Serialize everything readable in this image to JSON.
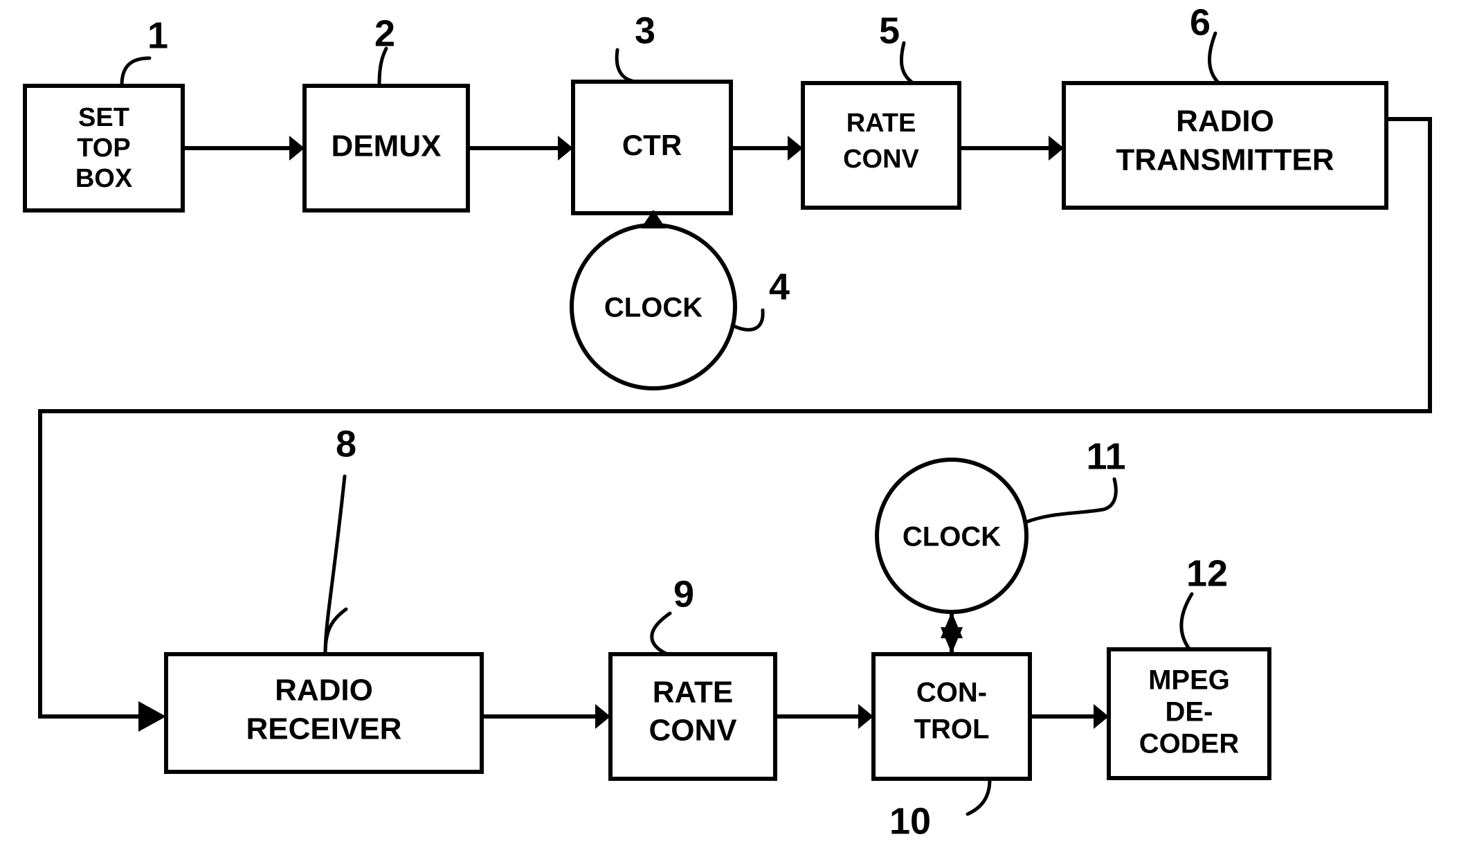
{
  "figure": {
    "type": "patent-block-diagram",
    "background_color": "#ffffff",
    "line_color": "#000000"
  },
  "blocks": {
    "set_top_box": {
      "label_line1": "SET",
      "label_line2": "TOP",
      "label_line3": "BOX",
      "ref": "1"
    },
    "demux": {
      "label": "DEMUX",
      "ref": "2"
    },
    "ctr": {
      "label": "CTR",
      "ref": "3"
    },
    "clock_tx": {
      "label": "CLOCK",
      "ref": "4"
    },
    "rate_conv_tx": {
      "label_line1": "RATE",
      "label_line2": "CONV",
      "ref": "5"
    },
    "radio_transmitter": {
      "label_line1": "RADIO",
      "label_line2": "TRANSMITTER",
      "ref": "6"
    },
    "radio_receiver": {
      "label_line1": "RADIO",
      "label_line2": "RECEIVER",
      "ref": "8"
    },
    "rate_conv_rx": {
      "label_line1": "RATE",
      "label_line2": "CONV",
      "ref": "9"
    },
    "control": {
      "label_line1": "CON-",
      "label_line2": "TROL",
      "ref": "10"
    },
    "clock_rx": {
      "label": "CLOCK",
      "ref": "11"
    },
    "mpeg_decoder": {
      "label_line1": "MPEG",
      "label_line2": "DE-",
      "label_line3": "CODER",
      "ref": "12"
    }
  }
}
